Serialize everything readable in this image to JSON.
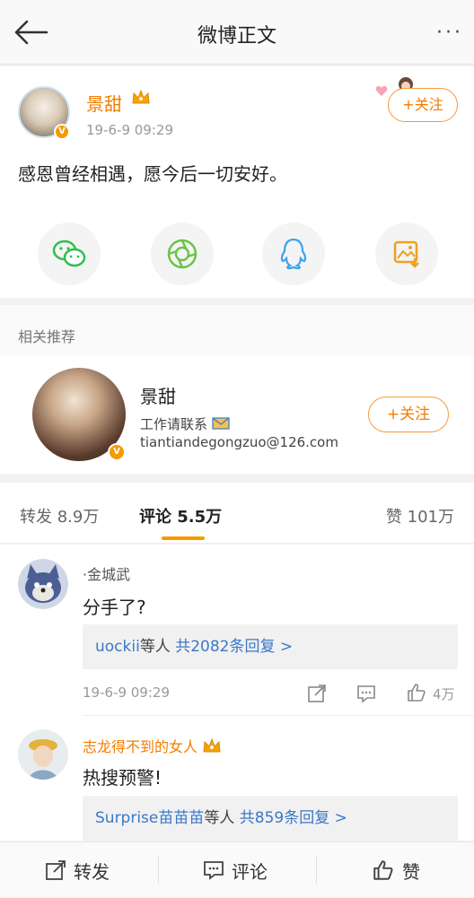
{
  "header": {
    "title": "微博正文",
    "more": "···"
  },
  "post": {
    "user_name": "景甜",
    "timestamp": "19-6-9 09:29",
    "text": "感恩曾经相遇，愿今后一切安好。",
    "follow_label": "+关注",
    "share_icons": [
      "wechat-icon",
      "moments-icon",
      "qq-icon",
      "save-image-icon"
    ]
  },
  "recommend": {
    "section_title": "相关推荐",
    "name": "景甜",
    "description": "工作请联系",
    "email": "tiantiandegongzuo@126.com",
    "follow_label": "+关注"
  },
  "tabs": {
    "repost": "转发 8.9万",
    "comment": "评论 5.5万",
    "like": "赞 101万"
  },
  "comments": [
    {
      "user": "·金城武",
      "text": "分手了?",
      "reply_users": "uockii",
      "reply_mid": "等人",
      "reply_count": "共2082条回复 >",
      "time": "19-6-9 09:29",
      "likes": "4万"
    },
    {
      "user": "志龙得不到的女人",
      "text": "热搜预警!",
      "reply_users": "Surprise苗苗苗",
      "reply_mid": "等人",
      "reply_count": "共859条回复 >"
    }
  ],
  "bottom": {
    "repost": "转发",
    "comment": "评论",
    "like": "赞"
  },
  "colors": {
    "accent": "#f27d00",
    "link": "#3a78c7",
    "tab_underline": "#f59a00"
  }
}
